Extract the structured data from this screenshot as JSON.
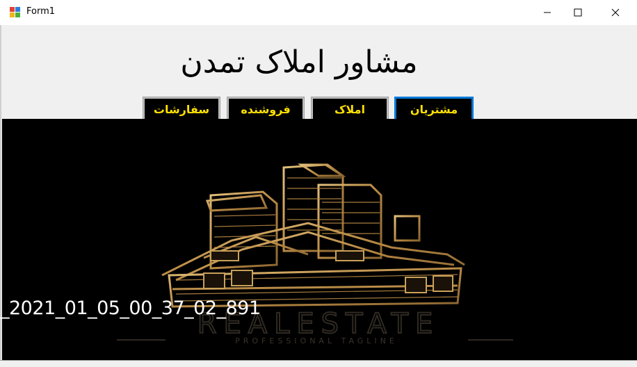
{
  "window": {
    "title": "Form1",
    "controls": [
      "minimize-icon",
      "maximize-icon",
      "close-icon"
    ]
  },
  "main": {
    "heading": "مشاور املاک تمدن",
    "buttons": [
      {
        "label": "مشتریان",
        "active": true
      },
      {
        "label": "املاک",
        "active": false
      },
      {
        "label": "فروشنده",
        "active": false
      },
      {
        "label": "سفارشات",
        "active": false
      }
    ]
  },
  "picture": {
    "overlay_text": "_2021_01_05_00_37_02_891",
    "logo_text": "REALESTATE",
    "tagline": "PROFESSIONAL TAGLINE"
  },
  "colors": {
    "button_text": "#ffe000",
    "button_bg": "#000000",
    "active_border": "#0078d7",
    "logo_gold": "#c9a15a"
  }
}
